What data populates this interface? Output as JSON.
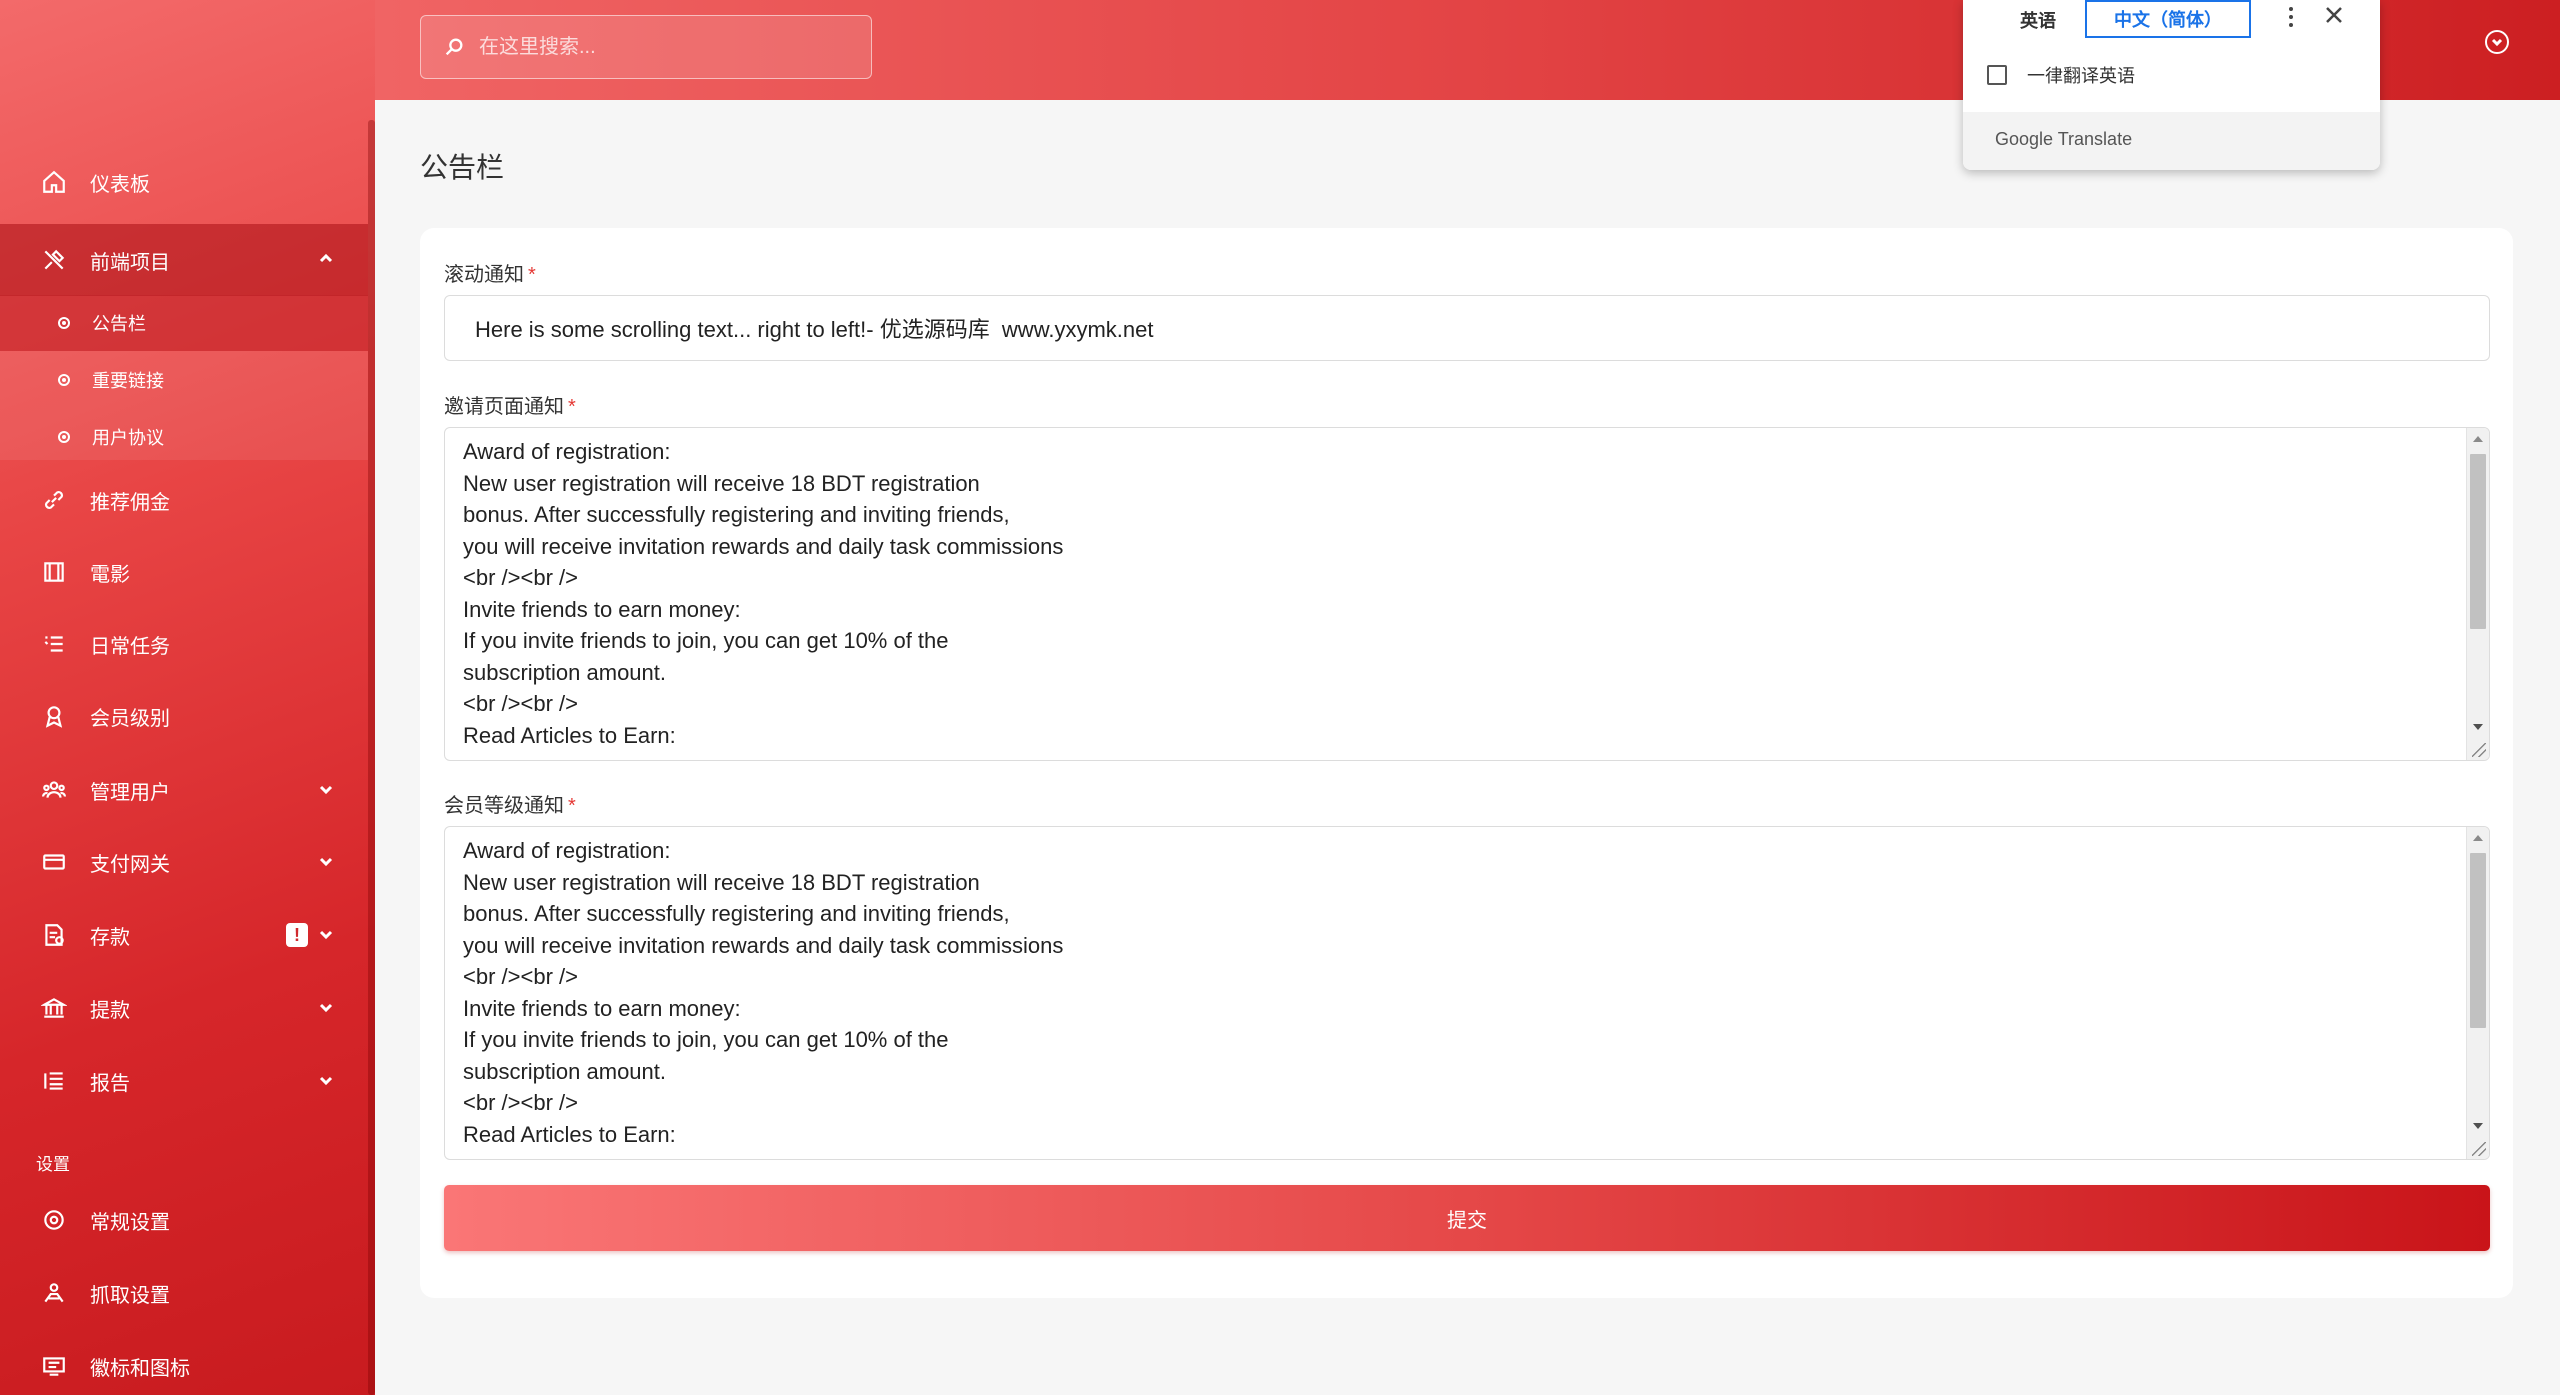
{
  "header": {
    "search_placeholder": "在这里搜索..."
  },
  "sidebar": {
    "items": [
      {
        "label": "仪表板",
        "icon": "home-icon"
      },
      {
        "label": "前端项目",
        "icon": "tools-icon"
      },
      {
        "label": "推荐佣金",
        "icon": "link-icon"
      },
      {
        "label": "電影",
        "icon": "film-icon"
      },
      {
        "label": "日常任务",
        "icon": "list-icon"
      },
      {
        "label": "会员级别",
        "icon": "award-icon"
      },
      {
        "label": "管理用户",
        "icon": "users-icon"
      },
      {
        "label": "支付网关",
        "icon": "card-icon"
      },
      {
        "label": "存款",
        "icon": "deposit-icon",
        "badge": "!"
      },
      {
        "label": "提款",
        "icon": "bank-icon"
      },
      {
        "label": "报告",
        "icon": "report-icon"
      },
      {
        "label": "常规设置",
        "icon": "settings-icon"
      },
      {
        "label": "抓取设置",
        "icon": "crawl-icon"
      },
      {
        "label": "徽标和图标",
        "icon": "logo-icon"
      }
    ],
    "subitems": [
      {
        "label": "公告栏"
      },
      {
        "label": "重要链接"
      },
      {
        "label": "用户协议"
      }
    ],
    "section_label": "设置"
  },
  "main": {
    "page_title": "公告栏",
    "scroll_label": "滚动通知",
    "scroll_value": "Here is some scrolling text... right to left!- 优选源码库  www.yxymk.net",
    "invite_label": "邀请页面通知",
    "invite_text": "Award of registration:\nNew user registration will receive 18 BDT registration\nbonus. After successfully registering and inviting friends,\nyou will receive invitation rewards and daily task commissions\n<br /><br />\nInvite friends to earn money:\nIf you invite friends to join, you can get 10% of the\nsubscription amount.\n<br /><br />\nRead Articles to Earn:",
    "level_label": "会员等级通知",
    "level_text": "Award of registration:\nNew user registration will receive 18 BDT registration\nbonus. After successfully registering and inviting friends,\nyou will receive invitation rewards and daily task commissions\n<br /><br />\nInvite friends to earn money:\nIf you invite friends to join, you can get 10% of the\nsubscription amount.\n<br /><br />\nRead Articles to Earn:",
    "required_mark": "*",
    "submit_label": "提交"
  },
  "translate_popup": {
    "tab_source": "英语",
    "tab_target": "中文（简体）",
    "option_label": "一律翻译英语",
    "brand": "Google Translate"
  },
  "colors": {
    "accent": "#e23c3e",
    "accent_dark": "#c81b1f",
    "link_blue": "#1a73e8"
  }
}
